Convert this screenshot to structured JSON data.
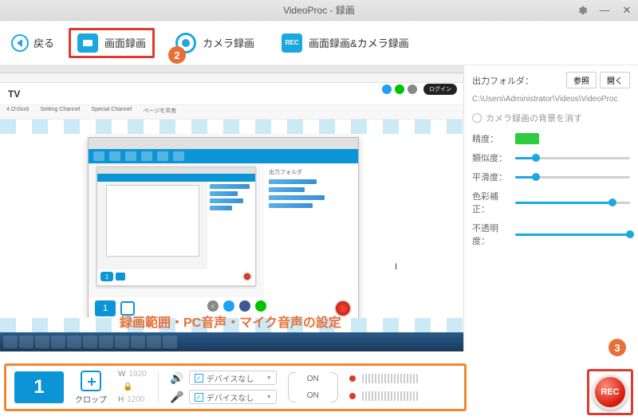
{
  "titlebar": {
    "title": "VideoProc - 録画"
  },
  "toolbar": {
    "back_label": "戻る",
    "modes": {
      "screen": "画面録画",
      "camera": "カメラ録画",
      "both": "画面録画&カメラ録画"
    }
  },
  "badges": {
    "step2": "2",
    "step3": "3"
  },
  "preview": {
    "tv_logo": "TV",
    "login": "ログイン",
    "nav": [
      "4 O'clock",
      "Setting Channel",
      "Special Channel",
      "ページを共有"
    ],
    "overlay_text": "録画範囲・PC音声・マイク音声の設定",
    "cursor_char": "I",
    "mini_number": "1"
  },
  "sidebar": {
    "folder_label": "出力フォルダ：",
    "browse_btn": "参照",
    "open_btn": "開く",
    "path": "C:\\Users\\Administrator\\Videos\\VideoProc",
    "erase_bg_label": "カメラ録画の背景を消す",
    "sliders": [
      {
        "label": "精度：",
        "type": "badge"
      },
      {
        "label": "類似度：",
        "value": 18
      },
      {
        "label": "平滑度：",
        "value": 18
      },
      {
        "label": "色彩補正：",
        "value": 85
      },
      {
        "label": "不透明度：",
        "value": 100
      }
    ]
  },
  "bottombar": {
    "number": "1",
    "crop_label": "クロップ",
    "dims": {
      "w_label": "W",
      "w": "1920",
      "h_label": "H",
      "h": "1200"
    },
    "device_none": "デバイスなし",
    "on_label": "ON"
  },
  "rec": {
    "label": "REC"
  }
}
